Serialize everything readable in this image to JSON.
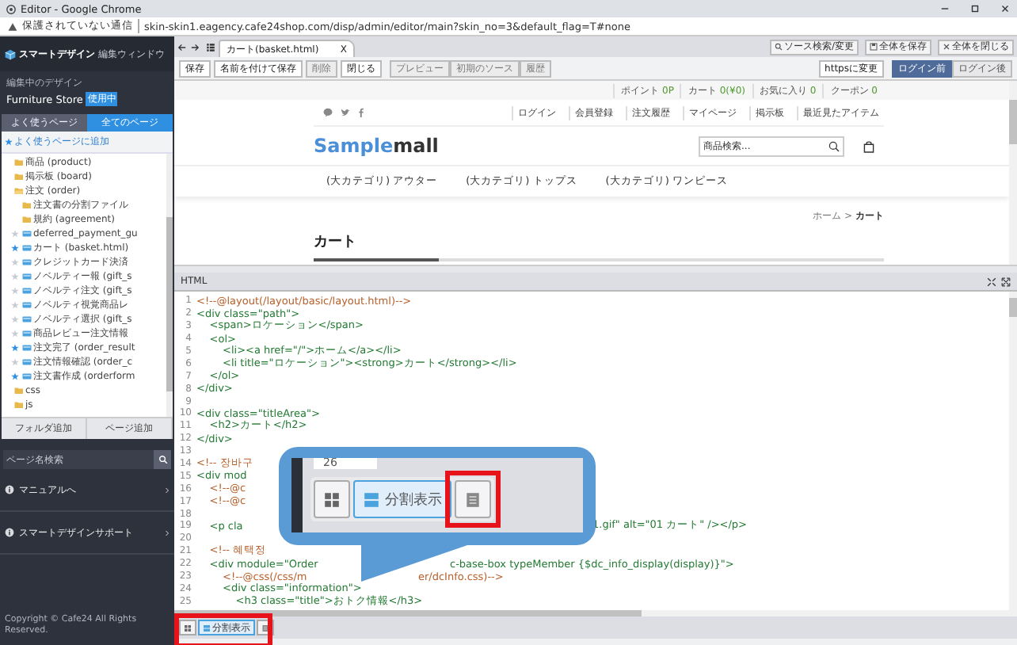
{
  "browser": {
    "title": "Editor - Google Chrome",
    "security": "保護されていない通信",
    "url": "skin-skin1.eagency.cafe24shop.com/disp/admin/editor/main?skin_no=3&default_flag=T#none"
  },
  "sidebar": {
    "app_title": "スマートデザイン",
    "app_subtitle": "編集ウィンドウ",
    "design_label": "編集中のデザイン",
    "design_name": "Furniture Store",
    "design_badge": "使用中",
    "tabs": [
      {
        "label": "よく使うページ",
        "selected": false
      },
      {
        "label": "全てのページ",
        "selected": true
      }
    ],
    "add_favorite": "よく使うページに追加",
    "tree": [
      {
        "kind": "folder",
        "label": "商品 (product)",
        "expanded": false
      },
      {
        "kind": "folder",
        "label": "掲示板 (board)",
        "expanded": false
      },
      {
        "kind": "folder",
        "label": "注文 (order)",
        "expanded": true,
        "children": [
          {
            "kind": "folder",
            "label": "注文書の分割ファイル",
            "expanded": false
          },
          {
            "kind": "folder",
            "label": "規約 (agreement)",
            "expanded": false
          },
          {
            "kind": "file",
            "label": "deferred_payment_gu",
            "starred": false
          },
          {
            "kind": "file",
            "label": "カート (basket.html)",
            "starred": true
          },
          {
            "kind": "file",
            "label": "クレジットカード決済",
            "starred": false
          },
          {
            "kind": "file",
            "label": "ノベルティー報 (gift_s",
            "starred": false
          },
          {
            "kind": "file",
            "label": "ノベルティ注文 (gift_s",
            "starred": false
          },
          {
            "kind": "file",
            "label": "ノベルティ視覚商品レ",
            "starred": false
          },
          {
            "kind": "file",
            "label": "ノベルティ選択 (gift_s",
            "starred": false
          },
          {
            "kind": "file",
            "label": "商品レビュー注文情報",
            "starred": false
          },
          {
            "kind": "file",
            "label": "注文完了 (order_result",
            "starred": true
          },
          {
            "kind": "file",
            "label": "注文情報確認 (order_c",
            "starred": false
          },
          {
            "kind": "file",
            "label": "注文書作成 (orderform",
            "starred": true
          }
        ]
      },
      {
        "kind": "folder",
        "label": "css",
        "expanded": false
      },
      {
        "kind": "folder",
        "label": "js",
        "expanded": false
      }
    ],
    "buttons": [
      "フォルダ追加",
      "ページ追加"
    ],
    "search": {
      "placeholder": "ページ名検索"
    },
    "links": [
      "マニュアルへ",
      "スマートデザインサポート"
    ],
    "copyright": "Copyright © Cafe24 All Rights Reserved."
  },
  "editor": {
    "tab": {
      "label": "カート(basket.html)",
      "close": "X"
    },
    "global_actions": [
      {
        "kind": "search",
        "label": "ソース検索/変更"
      },
      {
        "kind": "save",
        "label": "全体を保存"
      },
      {
        "kind": "close",
        "label": "全体を閉じる"
      }
    ],
    "toolbar": [
      [
        {
          "label": "保存",
          "disabled": false
        },
        {
          "label": "名前を付けて保存",
          "disabled": false
        },
        {
          "label": "削除",
          "disabled": true
        },
        {
          "label": "閉じる",
          "disabled": false
        }
      ],
      [
        {
          "label": "プレビュー",
          "disabled": true
        },
        {
          "label": "初期のソース",
          "disabled": true
        },
        {
          "label": "履歴",
          "disabled": true
        }
      ]
    ],
    "https_button": "httpsに変更",
    "login_modes": [
      {
        "label": "ログイン前",
        "selected": true
      },
      {
        "label": "ログイン後",
        "selected": false
      }
    ]
  },
  "preview": {
    "top_bar": [
      {
        "label": "ポイント",
        "value": "0P"
      },
      {
        "label": "カート",
        "value": "0(¥0)"
      },
      {
        "label": "お気に入り",
        "value": "0"
      },
      {
        "label": "クーポン",
        "value": "0"
      }
    ],
    "member_links": [
      "ログイン",
      "会員登録",
      "注文履歴",
      "マイページ",
      "掲示板",
      "最近見たアイテム"
    ],
    "logo": {
      "accent": "Sample",
      "rest": "mall"
    },
    "search": {
      "placeholder": "商品検索..."
    },
    "categories": [
      "(大カテゴリ) アウター",
      "(大カテゴリ) トップス",
      "(大カテゴリ) ワンピース"
    ],
    "breadcrumb": {
      "home": "ホーム",
      "separator": ">",
      "current": "カート"
    },
    "page_title": "カート"
  },
  "code_panel": {
    "title": "HTML",
    "lines": [
      {
        "number": "1",
        "kind": "comment",
        "text": "<!--@layout(/layout/basic/layout.html)-->"
      },
      {
        "number": "2",
        "kind": "markup",
        "text": "<div class=\"path\">"
      },
      {
        "number": "3",
        "kind": "markup",
        "text": "    <span>ロケーション</span>"
      },
      {
        "number": "4",
        "kind": "markup",
        "text": "    <ol>"
      },
      {
        "number": "5",
        "kind": "markup",
        "text": "        <li><a href=\"/\">ホーム</a></li>"
      },
      {
        "number": "6",
        "kind": "markup",
        "text": "        <li title=\"ロケーション\"><strong>カート</strong></li>"
      },
      {
        "number": "7",
        "kind": "markup",
        "text": "    </ol>"
      },
      {
        "number": "8",
        "kind": "markup",
        "text": "</div>"
      },
      {
        "number": "9"
      },
      {
        "number": "10",
        "kind": "markup",
        "text": "<div class=\"titleArea\">"
      },
      {
        "number": "11",
        "kind": "markup",
        "text": "    <h2>カート</h2>"
      },
      {
        "number": "12",
        "kind": "markup",
        "text": "</div>"
      },
      {
        "number": "13"
      },
      {
        "number": "14",
        "kind": "comment",
        "text": "<!-- 장바구"
      },
      {
        "number": "15",
        "kind": "markup",
        "text": "<div mod"
      },
      {
        "number": "16",
        "kind": "comment",
        "text": "    <!--@c"
      },
      {
        "number": "17",
        "kind": "comment",
        "text": "    <!--@c"
      },
      {
        "number": "18"
      },
      {
        "number": "19",
        "kind": "markup",
        "text": "    <p cla",
        "right": "1.gif\" alt=\"01 カート\" /></p>"
      },
      {
        "number": "20"
      },
      {
        "number": "21",
        "kind": "comment",
        "text": "    <!-- 혜택정"
      },
      {
        "number": "22",
        "kind": "markup",
        "text": "    <div module=\"Order",
        "right": "c-base-box typeMember {$dc_info_display(display)}\">"
      },
      {
        "number": "23",
        "kind": "comment",
        "text": "        <!--@css(/css/m",
        "right": "er/dcInfo.css)-->"
      },
      {
        "number": "24",
        "kind": "markup",
        "text": "        <div class=\"information\">"
      },
      {
        "number": "25",
        "kind": "markup",
        "text": "            <h3 class=\"title\">おトク情報</h3>"
      }
    ]
  },
  "view_switcher": [
    {
      "kind": "grid",
      "selected": false
    },
    {
      "kind": "split",
      "label": "分割表示",
      "selected": true
    },
    {
      "kind": "single",
      "selected": false
    }
  ],
  "callout": {
    "line_number": "26",
    "view_switcher": [
      {
        "kind": "grid",
        "selected": false
      },
      {
        "kind": "split",
        "label": "分割表示",
        "selected": true
      },
      {
        "kind": "single",
        "selected": false
      }
    ]
  }
}
